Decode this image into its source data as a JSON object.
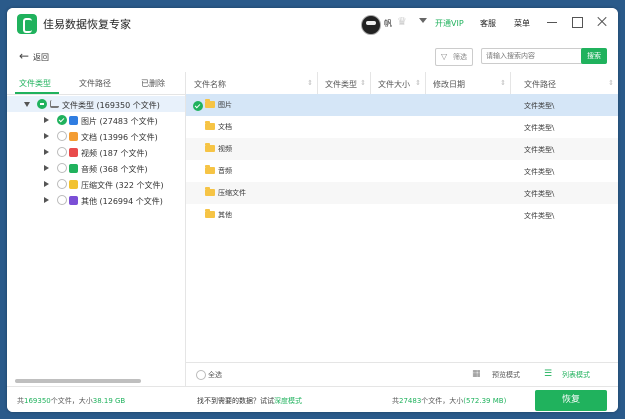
{
  "titlebar": {
    "app_title": "佳易数据恢复专家",
    "username": "帆",
    "vip_label": "开通VIP",
    "service_label": "客服",
    "menu_label": "菜单"
  },
  "toolbar": {
    "back_label": "返回",
    "filter_label": "筛选",
    "search_placeholder": "请输入搜索内容",
    "search_button": "搜索"
  },
  "left_panel": {
    "tabs": [
      {
        "label": "文件类型",
        "active": true
      },
      {
        "label": "文件路径",
        "active": false
      },
      {
        "label": "已删除",
        "active": false
      }
    ],
    "tree": {
      "root_label": "文件类型 (169350 个文件)",
      "children": [
        {
          "label": "图片 (27483 个文件)",
          "checked": true,
          "icon": "image-icon",
          "color": "#2f7de1"
        },
        {
          "label": "文档 (13996 个文件)",
          "checked": false,
          "icon": "document-icon",
          "color": "#f39c32"
        },
        {
          "label": "视频 (187 个文件)",
          "checked": false,
          "icon": "video-icon",
          "color": "#e94b4b"
        },
        {
          "label": "音频 (368 个文件)",
          "checked": false,
          "icon": "audio-icon",
          "color": "#20b25d"
        },
        {
          "label": "压缩文件 (322 个文件)",
          "checked": false,
          "icon": "archive-icon",
          "color": "#f2c230"
        },
        {
          "label": "其他 (126994 个文件)",
          "checked": false,
          "icon": "other-icon",
          "color": "#7b4fd6"
        }
      ]
    }
  },
  "table": {
    "columns": [
      "文件名称",
      "文件类型",
      "文件大小",
      "修改日期",
      "文件路径"
    ],
    "rows": [
      {
        "name": "图片",
        "path": "文件类型\\",
        "selected": true
      },
      {
        "name": "文档",
        "path": "文件类型\\",
        "selected": false
      },
      {
        "name": "视频",
        "path": "文件类型\\",
        "selected": false
      },
      {
        "name": "音频",
        "path": "文件类型\\",
        "selected": false
      },
      {
        "name": "压缩文件",
        "path": "文件类型\\",
        "selected": false
      },
      {
        "name": "其他",
        "path": "文件类型\\",
        "selected": false
      }
    ],
    "select_all_label": "全选",
    "preview_mode_label": "预览模式",
    "list_mode_label": "列表模式"
  },
  "footer": {
    "left_prefix": "共",
    "left_count": "169350",
    "left_mid": "个文件，大小",
    "left_size": "38.19 GB",
    "mid_text": "找不到需要的数据？试试",
    "mid_link": "深度模式",
    "right_prefix": "共",
    "right_count": "27483",
    "right_mid": "个文件，大小",
    "right_size": "(572.39 MB)",
    "recover_label": "恢复"
  },
  "colors": {
    "accent": "#20b25d",
    "selected_row": "#d5e6f7"
  }
}
